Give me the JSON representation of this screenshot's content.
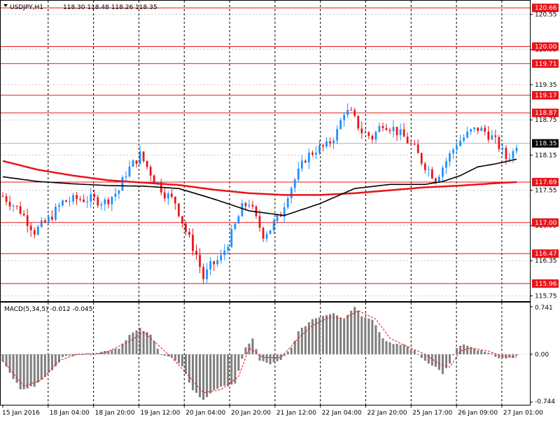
{
  "header": {
    "symbol_label": "USDJPY,H1",
    "ohlc_label": "118.30 118.48 118.26 118.35",
    "menu_icon": "triangle-down-icon"
  },
  "indicator": {
    "label": "MACD(5,34,5) -0.012 -0.045"
  },
  "colors": {
    "bull": "#1e90ff",
    "bear": "#e8141a",
    "level": "#e8141a",
    "ma_slow": "#e8141a",
    "ma_fast": "#000000",
    "histogram": "#7f7f7f",
    "signal": "#e8141a",
    "price_tag": "#000000",
    "grid": "#000000"
  },
  "chart_data": [
    {
      "type": "candlestick",
      "instrument": "USDJPY",
      "timeframe": "H1",
      "ylim": [
        115.66,
        120.77
      ],
      "y_ticks": [
        "120.55",
        "119.95",
        "119.35",
        "118.75",
        "118.15",
        "117.55",
        "116.95",
        "116.35",
        "115.75"
      ],
      "x_ticks": [
        "15 Jan 2016",
        "18 Jan 04:00",
        "18 Jan 20:00",
        "19 Jan 12:00",
        "20 Jan 04:00",
        "20 Jan 20:00",
        "21 Jan 12:00",
        "22 Jan 04:00",
        "22 Jan 20:00",
        "25 Jan 17:00",
        "26 Jan 09:00",
        "27 Jan 01:00"
      ],
      "levels": [
        "120.66",
        "120.00",
        "119.71",
        "119.17",
        "118.87",
        "117.69",
        "117.00",
        "116.47",
        "115.96"
      ],
      "current_price": "118.35",
      "candle_count": 147,
      "close_path": [
        [
          0,
          117.45
        ],
        [
          5,
          117.2
        ],
        [
          9,
          116.85
        ],
        [
          13,
          117.05
        ],
        [
          17,
          117.35
        ],
        [
          21,
          117.4
        ],
        [
          25,
          117.4
        ],
        [
          29,
          117.35
        ],
        [
          33,
          117.55
        ],
        [
          35,
          117.85
        ],
        [
          37,
          118.0
        ],
        [
          39,
          118.15
        ],
        [
          41,
          117.95
        ],
        [
          43,
          117.75
        ],
        [
          46,
          117.5
        ],
        [
          49,
          117.35
        ],
        [
          52,
          116.85
        ],
        [
          55,
          116.45
        ],
        [
          57,
          116.05
        ],
        [
          59,
          116.25
        ],
        [
          62,
          116.4
        ],
        [
          65,
          116.8
        ],
        [
          68,
          117.25
        ],
        [
          70,
          117.35
        ],
        [
          72,
          117.05
        ],
        [
          74,
          116.8
        ],
        [
          76,
          116.9
        ],
        [
          79,
          117.15
        ],
        [
          81,
          117.5
        ],
        [
          84,
          117.85
        ],
        [
          86,
          118.1
        ],
        [
          89,
          118.25
        ],
        [
          92,
          118.3
        ],
        [
          95,
          118.55
        ],
        [
          97,
          118.9
        ],
        [
          99,
          118.85
        ],
        [
          102,
          118.55
        ],
        [
          105,
          118.45
        ],
        [
          108,
          118.7
        ],
        [
          111,
          118.6
        ],
        [
          114,
          118.45
        ],
        [
          117,
          118.25
        ],
        [
          119,
          118.05
        ],
        [
          121,
          117.9
        ],
        [
          123,
          117.75
        ],
        [
          125,
          117.95
        ],
        [
          127,
          118.15
        ],
        [
          129,
          118.35
        ],
        [
          131,
          118.45
        ],
        [
          133,
          118.55
        ],
        [
          135,
          118.6
        ],
        [
          137,
          118.55
        ],
        [
          139,
          118.45
        ],
        [
          141,
          118.3
        ],
        [
          143,
          118.1
        ],
        [
          145,
          118.2
        ],
        [
          146,
          118.35
        ]
      ],
      "series": [
        {
          "values_path": [
            [
              0,
              118.05
            ],
            [
              10,
              117.9
            ],
            [
              20,
              117.8
            ],
            [
              30,
              117.72
            ],
            [
              40,
              117.68
            ],
            [
              50,
              117.64
            ],
            [
              60,
              117.56
            ],
            [
              70,
              117.5
            ],
            [
              80,
              117.47
            ],
            [
              90,
              117.47
            ],
            [
              100,
              117.5
            ],
            [
              110,
              117.55
            ],
            [
              120,
              117.6
            ],
            [
              130,
              117.63
            ],
            [
              140,
              117.67
            ],
            [
              146,
              117.69
            ]
          ]
        },
        {
          "values_path": [
            [
              0,
              117.78
            ],
            [
              10,
              117.7
            ],
            [
              20,
              117.66
            ],
            [
              30,
              117.63
            ],
            [
              40,
              117.62
            ],
            [
              50,
              117.58
            ],
            [
              60,
              117.4
            ],
            [
              70,
              117.2
            ],
            [
              80,
              117.12
            ],
            [
              90,
              117.32
            ],
            [
              100,
              117.58
            ],
            [
              110,
              117.65
            ],
            [
              120,
              117.65
            ],
            [
              125,
              117.7
            ],
            [
              130,
              117.8
            ],
            [
              135,
              117.95
            ],
            [
              140,
              118.0
            ],
            [
              146,
              118.08
            ]
          ]
        }
      ]
    },
    {
      "type": "bar",
      "indicator": "MACD",
      "params": [
        5,
        34,
        5
      ],
      "main_value": "-0.012",
      "signal_value": "-0.045",
      "y_ticks": [
        "0.741",
        "0.00",
        "-0.744"
      ],
      "ylim": [
        -0.744,
        0.741
      ],
      "histogram_path": [
        [
          0,
          -0.1
        ],
        [
          5,
          -0.55
        ],
        [
          9,
          -0.5
        ],
        [
          13,
          -0.3
        ],
        [
          17,
          -0.05
        ],
        [
          21,
          0.0
        ],
        [
          25,
          0.0
        ],
        [
          29,
          0.05
        ],
        [
          33,
          0.1
        ],
        [
          36,
          0.3
        ],
        [
          39,
          0.4
        ],
        [
          42,
          0.3
        ],
        [
          45,
          0.0
        ],
        [
          48,
          -0.05
        ],
        [
          51,
          -0.2
        ],
        [
          54,
          -0.55
        ],
        [
          57,
          -0.72
        ],
        [
          60,
          -0.55
        ],
        [
          63,
          -0.5
        ],
        [
          66,
          -0.45
        ],
        [
          69,
          0.1
        ],
        [
          71,
          0.25
        ],
        [
          73,
          -0.1
        ],
        [
          76,
          -0.15
        ],
        [
          79,
          -0.1
        ],
        [
          82,
          0.1
        ],
        [
          84,
          0.35
        ],
        [
          86,
          0.45
        ],
        [
          88,
          0.55
        ],
        [
          91,
          0.6
        ],
        [
          94,
          0.65
        ],
        [
          97,
          0.55
        ],
        [
          100,
          0.75
        ],
        [
          102,
          0.6
        ],
        [
          105,
          0.55
        ],
        [
          108,
          0.25
        ],
        [
          111,
          0.15
        ],
        [
          114,
          0.15
        ],
        [
          117,
          0.05
        ],
        [
          120,
          -0.1
        ],
        [
          123,
          -0.2
        ],
        [
          125,
          -0.3
        ],
        [
          127,
          -0.15
        ],
        [
          129,
          0.1
        ],
        [
          131,
          0.15
        ],
        [
          133,
          0.1
        ],
        [
          136,
          0.05
        ],
        [
          139,
          0.0
        ],
        [
          141,
          -0.05
        ],
        [
          143,
          -0.08
        ],
        [
          145,
          -0.05
        ],
        [
          146,
          -0.01
        ]
      ],
      "signal_path": [
        [
          0,
          -0.1
        ],
        [
          6,
          -0.5
        ],
        [
          11,
          -0.4
        ],
        [
          16,
          -0.1
        ],
        [
          21,
          0.0
        ],
        [
          29,
          0.02
        ],
        [
          36,
          0.2
        ],
        [
          40,
          0.35
        ],
        [
          44,
          0.15
        ],
        [
          48,
          -0.05
        ],
        [
          53,
          -0.35
        ],
        [
          57,
          -0.6
        ],
        [
          62,
          -0.55
        ],
        [
          67,
          -0.35
        ],
        [
          70,
          0.1
        ],
        [
          74,
          -0.05
        ],
        [
          79,
          -0.05
        ],
        [
          84,
          0.25
        ],
        [
          88,
          0.45
        ],
        [
          93,
          0.58
        ],
        [
          97,
          0.55
        ],
        [
          101,
          0.68
        ],
        [
          106,
          0.55
        ],
        [
          110,
          0.25
        ],
        [
          115,
          0.12
        ],
        [
          120,
          0.0
        ],
        [
          124,
          -0.15
        ],
        [
          127,
          -0.2
        ],
        [
          130,
          0.05
        ],
        [
          133,
          0.1
        ],
        [
          138,
          0.05
        ],
        [
          142,
          -0.03
        ],
        [
          146,
          -0.045
        ]
      ]
    }
  ]
}
